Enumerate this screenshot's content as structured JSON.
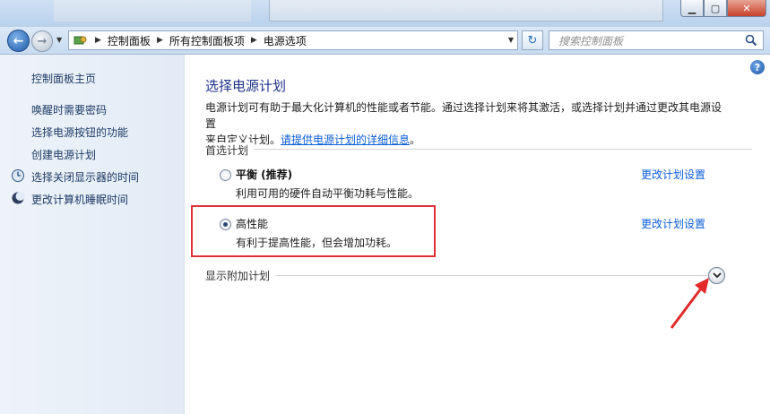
{
  "window": {
    "minimize_icon": "minimize-icon",
    "maximize_icon": "maximize-icon",
    "close_icon": "close-icon"
  },
  "address_bar": {
    "crumbs": [
      "控制面板",
      "所有控制面板项",
      "电源选项"
    ],
    "search_placeholder": "搜索控制面板"
  },
  "sidebar": {
    "home": "控制面板主页",
    "items": [
      "唤醒时需要密码",
      "选择电源按钮的功能",
      "创建电源计划",
      "选择关闭显示器的时间",
      "更改计算机睡眠时间"
    ]
  },
  "main": {
    "title": "选择电源计划",
    "description": "电源计划可有助于最大化计算机的性能或者节能。通过选择计划来将其激活，或选择计划并通过更改其电源设置",
    "description2": "来自定义计划。",
    "learn_more_link": "请提供电源计划的详细信息",
    "learn_more_suffix": "。",
    "preferred_group": "首选计划",
    "plans": [
      {
        "name": "平衡 (推荐)",
        "desc": "利用可用的硬件自动平衡功耗与性能。",
        "change": "更改计划设置",
        "selected": false
      },
      {
        "name": "高性能",
        "desc": "有利于提高性能，但会增加功耗。",
        "change": "更改计划设置",
        "selected": true
      }
    ],
    "extra_group": "显示附加计划",
    "help": "?"
  },
  "colors": {
    "link": "#0b5dd8",
    "title": "#1e3287",
    "highlight": "#e0303a"
  }
}
